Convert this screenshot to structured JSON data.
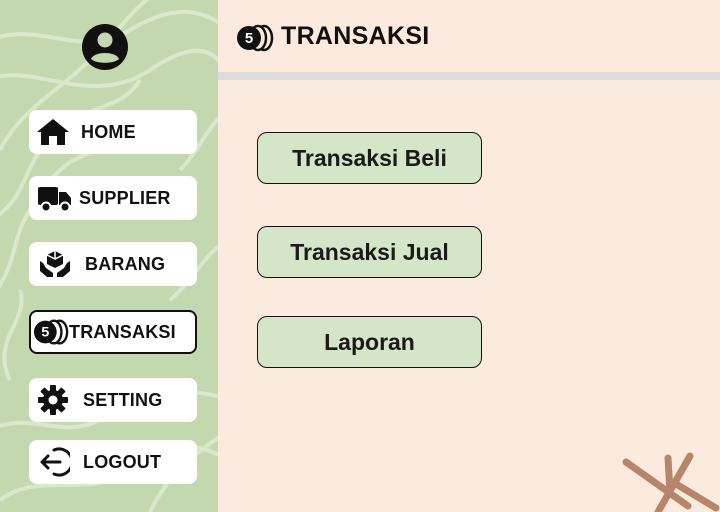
{
  "header": {
    "title": "TRANSAKSI",
    "icon": "coins-icon"
  },
  "sidebar": {
    "items": [
      {
        "label": "HOME",
        "icon": "home-icon"
      },
      {
        "label": "SUPPLIER",
        "icon": "truck-icon"
      },
      {
        "label": "BARANG",
        "icon": "box-hands-icon"
      },
      {
        "label": "TRANSAKSI",
        "icon": "coins-icon",
        "active": true
      },
      {
        "label": "SETTING",
        "icon": "gear-icon"
      },
      {
        "label": "LOGOUT",
        "icon": "logout-icon"
      }
    ]
  },
  "main": {
    "buttons": [
      {
        "label": "Transaksi Beli"
      },
      {
        "label": "Transaksi Jual"
      },
      {
        "label": "Laporan"
      }
    ]
  },
  "icon_glyphs": {
    "coin_number": "5"
  },
  "colors": {
    "sidebar_bg": "#c4d8b0",
    "main_bg": "#fdeade",
    "button_bg": "#d5e5c7",
    "divider": "#dcdcdc",
    "decoration": "#b7856a"
  }
}
